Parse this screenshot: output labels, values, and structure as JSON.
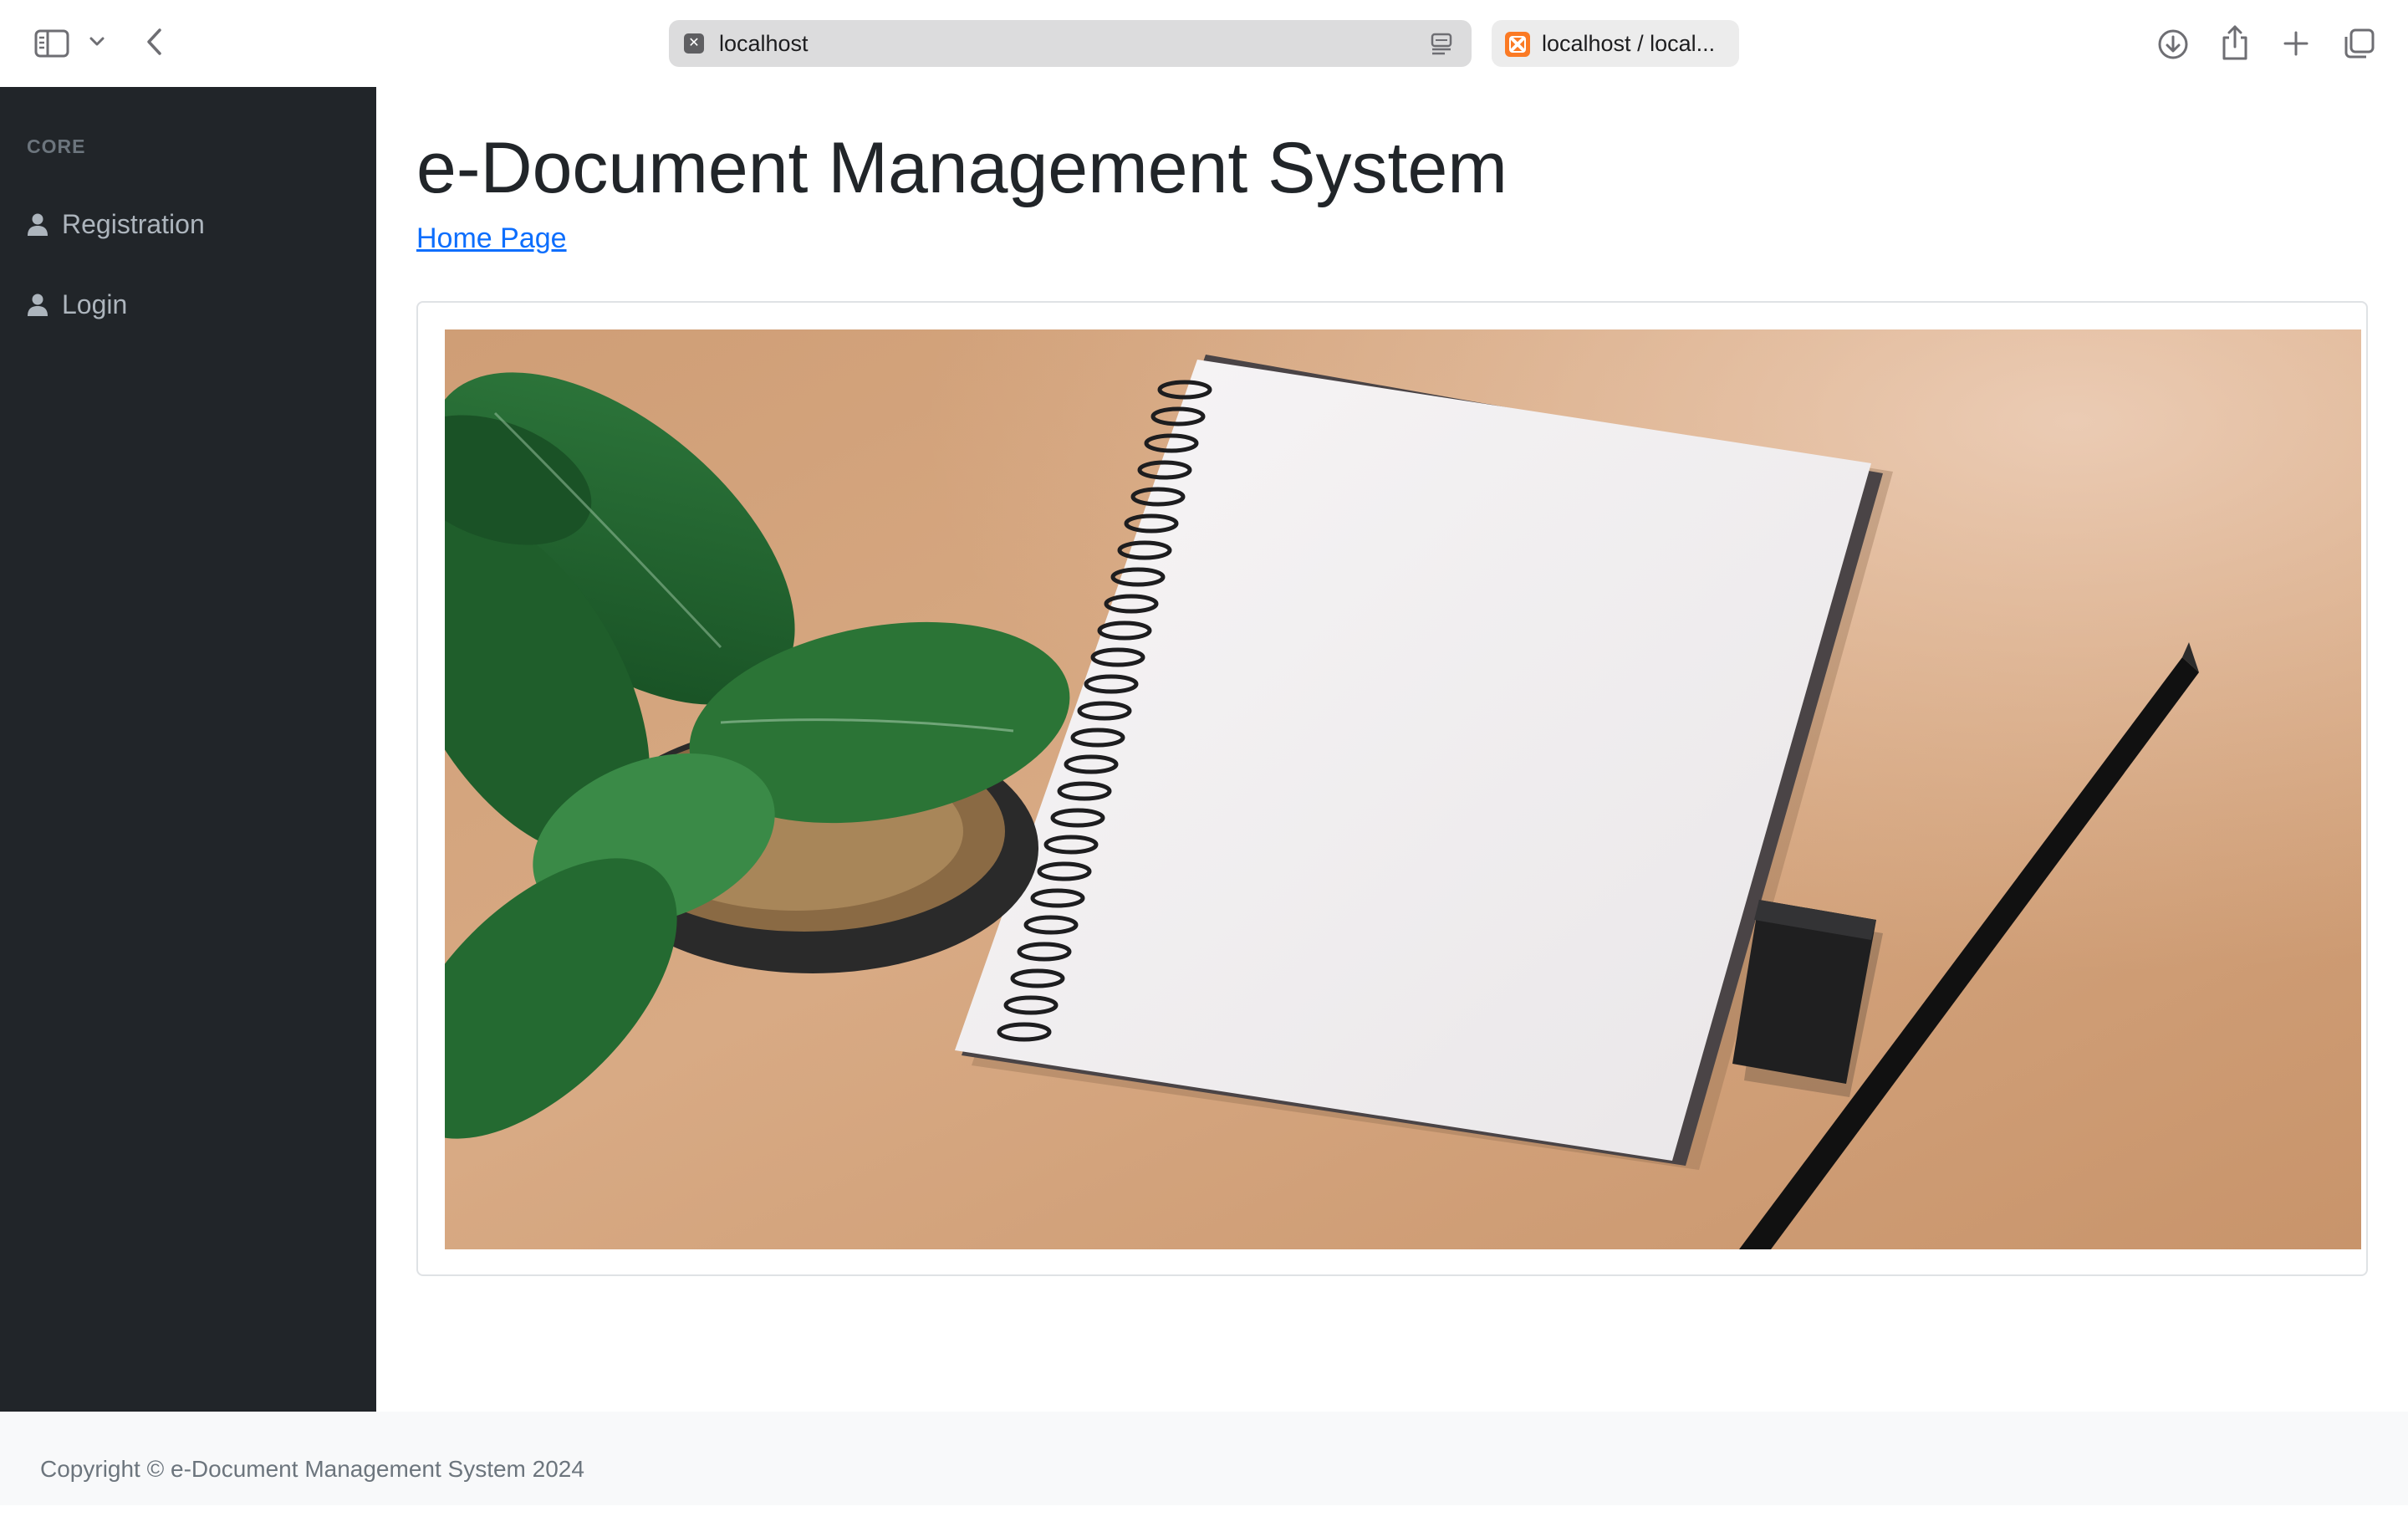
{
  "browser": {
    "address": "localhost",
    "second_tab": "localhost / local...",
    "icons": [
      "sidebar-toggle-icon",
      "chevron-down-icon",
      "back-icon",
      "reader-icon",
      "download-icon",
      "share-icon",
      "plus-icon",
      "tabs-overview-icon"
    ]
  },
  "sidebar": {
    "heading": "CORE",
    "items": [
      {
        "label": "Registration",
        "icon": "user-icon"
      },
      {
        "label": "Login",
        "icon": "user-icon"
      }
    ]
  },
  "main": {
    "title": "e-Document Management System",
    "home_link": "Home Page"
  },
  "footer": {
    "copyright": "Copyright © e-Document Management System 2024"
  },
  "colors": {
    "sidebar_bg": "#212529",
    "link": "#0d6efd",
    "footer_bg": "#f8f9fa"
  }
}
